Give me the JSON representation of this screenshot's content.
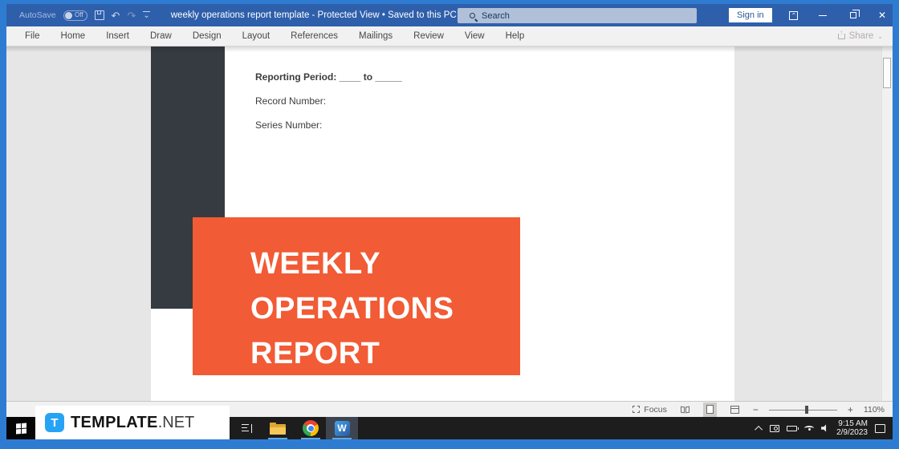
{
  "titlebar": {
    "autosave_label": "AutoSave",
    "autosave_state": "Off",
    "title": "weekly operations report template - Protected View • Saved to this PC",
    "search_placeholder": "Search",
    "signin_label": "Sign in"
  },
  "icons": {
    "undo": "↶",
    "redo": "↷",
    "caret": "⌄",
    "close": "✕",
    "minus": "−",
    "plus": "+"
  },
  "ribbon": {
    "tabs": [
      "File",
      "Home",
      "Insert",
      "Draw",
      "Design",
      "Layout",
      "References",
      "Mailings",
      "Review",
      "View",
      "Help"
    ],
    "share_label": "Share"
  },
  "document": {
    "fields": [
      {
        "label": "Reporting Period: ",
        "value": "____ to _____"
      },
      {
        "label": "Record Number:",
        "value": ""
      },
      {
        "label": "Series Number:",
        "value": ""
      }
    ],
    "title_lines": [
      "WEEKLY",
      "OPERATIONS",
      "REPORT"
    ],
    "accent_orange": "#F15B35",
    "block_dark": "#363B42"
  },
  "statusbar": {
    "focus_label": "Focus",
    "zoom_level": "110%"
  },
  "taskbar": {
    "brand_letter": "T",
    "brand_bold": "TEMPLATE",
    "brand_suffix": ".NET",
    "word_letter": "W",
    "clock_time": "9:15 AM",
    "clock_date": "2/9/2023"
  }
}
